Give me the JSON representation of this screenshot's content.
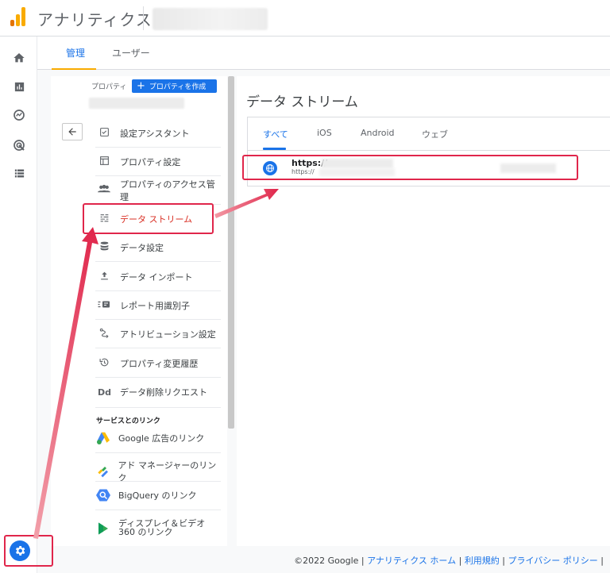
{
  "app": {
    "title": "アナリティクス"
  },
  "colors": {
    "accent": "#1a73e8",
    "highlight": "#e0264b",
    "tab_underline": "#f9ab00"
  },
  "rail_icons": [
    "home-icon",
    "reports-icon",
    "explore-icon",
    "advertising-icon",
    "configure-icon"
  ],
  "tabs": [
    {
      "label": "管理",
      "active": true
    },
    {
      "label": "ユーザー",
      "active": false
    }
  ],
  "property": {
    "label": "プロパティ",
    "create_button": "プロパティを作成"
  },
  "menu": [
    {
      "label": "設定アシスタント",
      "icon": "checklist-icon"
    },
    {
      "label": "プロパティ設定",
      "icon": "property-settings-icon"
    },
    {
      "label": "プロパティのアクセス管理",
      "icon": "people-icon"
    },
    {
      "label": "データ ストリーム",
      "icon": "data-streams-icon",
      "active": true
    },
    {
      "label": "データ設定",
      "icon": "database-icon"
    },
    {
      "label": "データ インポート",
      "icon": "upload-icon"
    },
    {
      "label": "レポート用識別子",
      "icon": "identifier-icon"
    },
    {
      "label": "アトリビューション設定",
      "icon": "attribution-icon"
    },
    {
      "label": "プロパティ変更履歴",
      "icon": "history-icon"
    },
    {
      "label": "データ削除リクエスト",
      "icon": "data-deletion-icon"
    }
  ],
  "links_section": {
    "title": "サービスとのリンク",
    "items": [
      {
        "label": "Google 広告のリンク",
        "icon": "google-ads-icon"
      },
      {
        "label": "アド マネージャーのリンク",
        "icon": "ad-manager-icon"
      },
      {
        "label": "BigQuery のリンク",
        "icon": "bigquery-icon"
      },
      {
        "label": "ディスプレイ＆ビデオ 360 のリンク",
        "icon": "display-video-icon"
      }
    ]
  },
  "data_streams": {
    "title": "データ ストリーム",
    "tabs": [
      {
        "label": "すべて",
        "active": true
      },
      {
        "label": "iOS",
        "active": false
      },
      {
        "label": "Android",
        "active": false
      },
      {
        "label": "ウェブ",
        "active": false
      }
    ],
    "stream": {
      "url": "https://",
      "sub_url": "https://",
      "icon": "globe-icon"
    }
  },
  "footer": {
    "copyright": "©2022 Google",
    "links": [
      "アナリティクス ホーム",
      "利用規約",
      "プライバシー ポリシー"
    ]
  }
}
